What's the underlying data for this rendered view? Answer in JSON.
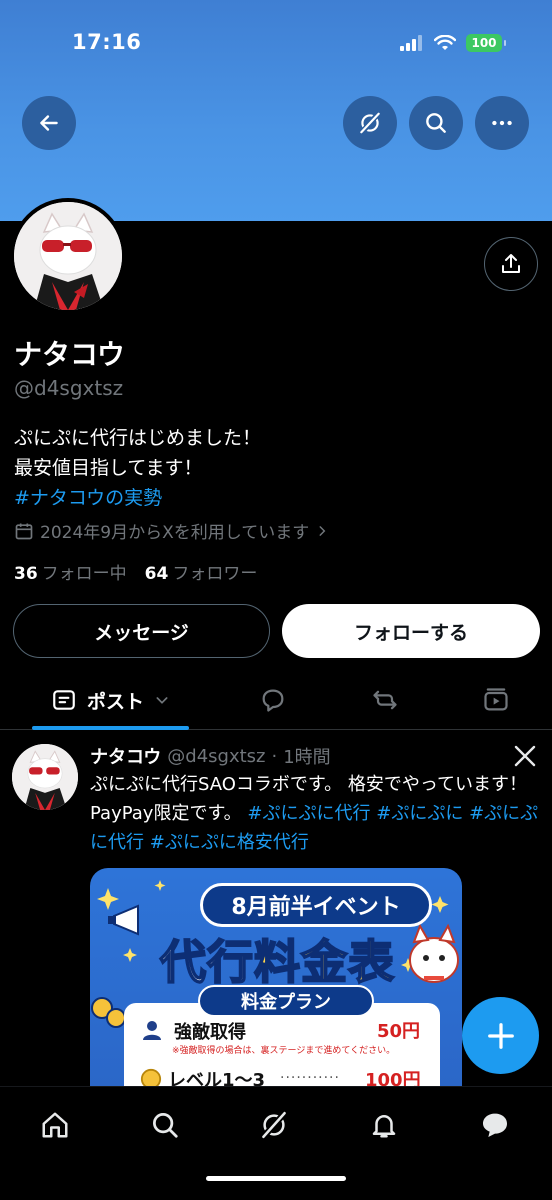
{
  "status_bar": {
    "time": "17:16",
    "battery": "100"
  },
  "profile": {
    "name": "ナタコウ",
    "handle": "@d4sgxtsz",
    "bio_lines": [
      "ぷにぷに代行はじめました！",
      "最安値目指してます！"
    ],
    "bio_hashtag": "#ナタコウの実勢",
    "joined": "2024年9月からXを利用しています",
    "following_count": "36",
    "following_label": "フォロー中",
    "followers_count": "64",
    "followers_label": "フォロワー",
    "message_button": "メッセージ",
    "follow_button": "フォローする"
  },
  "tabs": {
    "active_label": "ポスト"
  },
  "post": {
    "author_name": "ナタコウ",
    "author_handle": "@d4sgxtsz",
    "separator": "·",
    "time": "1時間",
    "text_plain": "ぷにぷに代行SAOコラボです。 格安でやっています！PayPay限定です。",
    "hashtags": [
      "#ぷにぷに代行",
      "#ぷにぷに",
      "#ぷにぷに代行",
      "#ぷにぷに格安代行"
    ],
    "image": {
      "pill": "8月前半イベント",
      "title_part1": "代行",
      "title_part2": "料金表",
      "plan_header": "料金プラン",
      "row1_label": "強敵取得",
      "row1_price": "50円",
      "row1_note": "※強敵取得の場合は、裏ステージまで進めてください。",
      "row2_label": "レベル1～3",
      "row2_dots": "...........",
      "row2_price": "100円"
    }
  },
  "icons": {
    "back": "arrow-left-icon",
    "grok": "grok-icon",
    "search": "search-icon",
    "more": "more-icon",
    "share": "share-icon",
    "calendar": "calendar-icon",
    "compose": "plus-icon"
  },
  "colors": {
    "accent": "#1d9bf0",
    "banner": "#4a94e5",
    "background": "#000000"
  }
}
